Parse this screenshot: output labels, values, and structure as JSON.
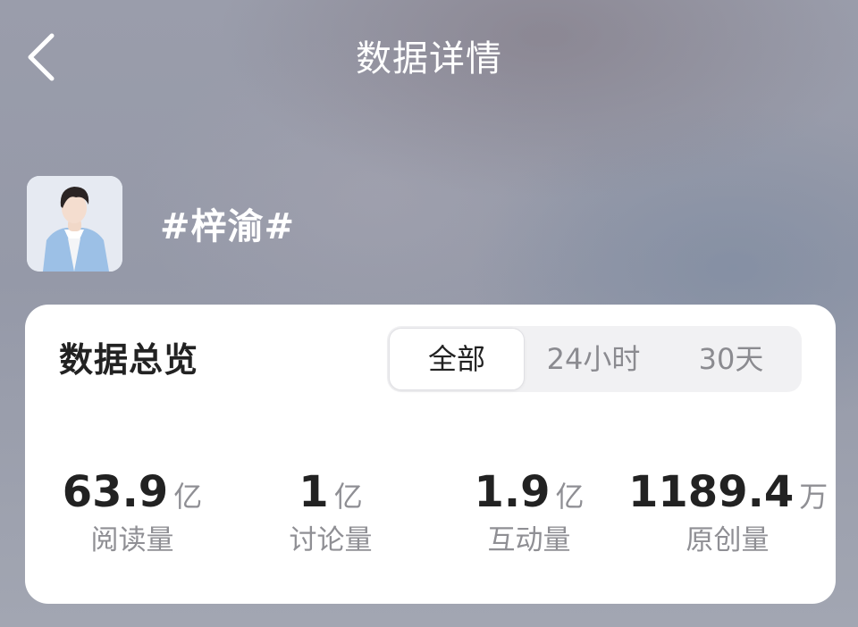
{
  "header": {
    "title": "数据详情",
    "back_icon": "chevron-left-icon"
  },
  "topic": {
    "name": "#梓渝#",
    "avatar_icon": "person-photo"
  },
  "overview": {
    "title": "数据总览",
    "tabs": [
      {
        "label": "全部",
        "active": true
      },
      {
        "label": "24小时",
        "active": false
      },
      {
        "label": "30天",
        "active": false
      }
    ],
    "stats": [
      {
        "value": "63.9",
        "unit": "亿",
        "label": "阅读量"
      },
      {
        "value": "1",
        "unit": "亿",
        "label": "讨论量"
      },
      {
        "value": "1.9",
        "unit": "亿",
        "label": "互动量"
      },
      {
        "value": "1189.4",
        "unit": "万",
        "label": "原创量"
      }
    ]
  },
  "colors": {
    "text_primary": "#222222",
    "text_secondary": "#8f8f94",
    "card_background": "#ffffff",
    "header_text": "#ffffff"
  }
}
